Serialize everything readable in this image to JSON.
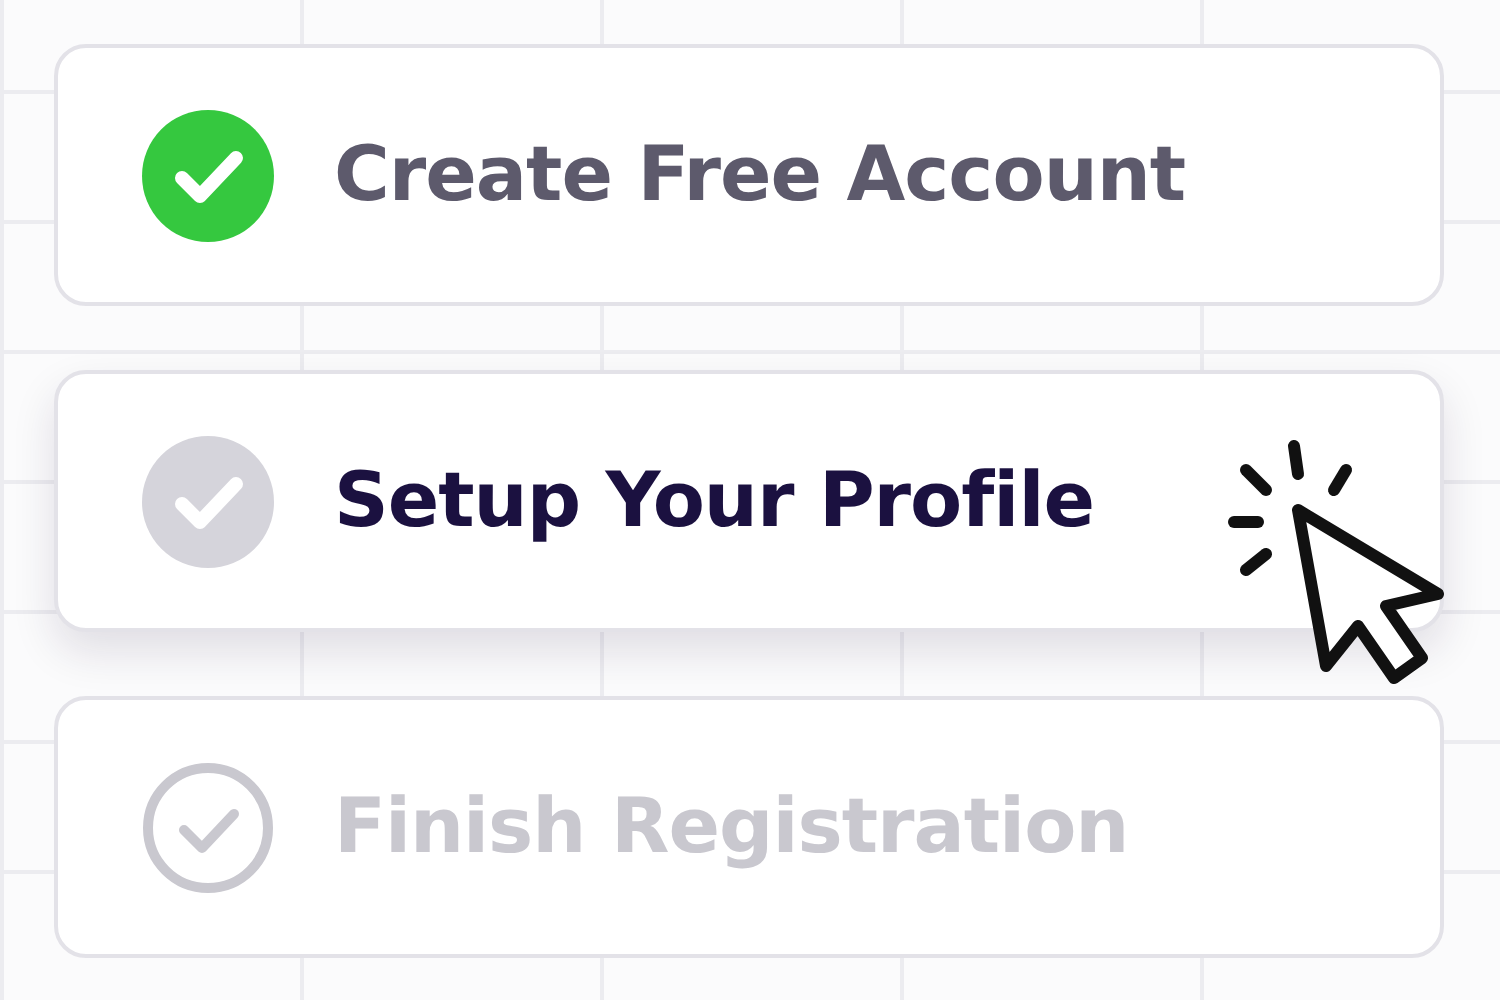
{
  "steps": [
    {
      "label": "Create Free Account",
      "kind": "done"
    },
    {
      "label": "Setup Your Profile",
      "kind": "current"
    },
    {
      "label": "Finish Registration",
      "kind": "pending"
    }
  ]
}
